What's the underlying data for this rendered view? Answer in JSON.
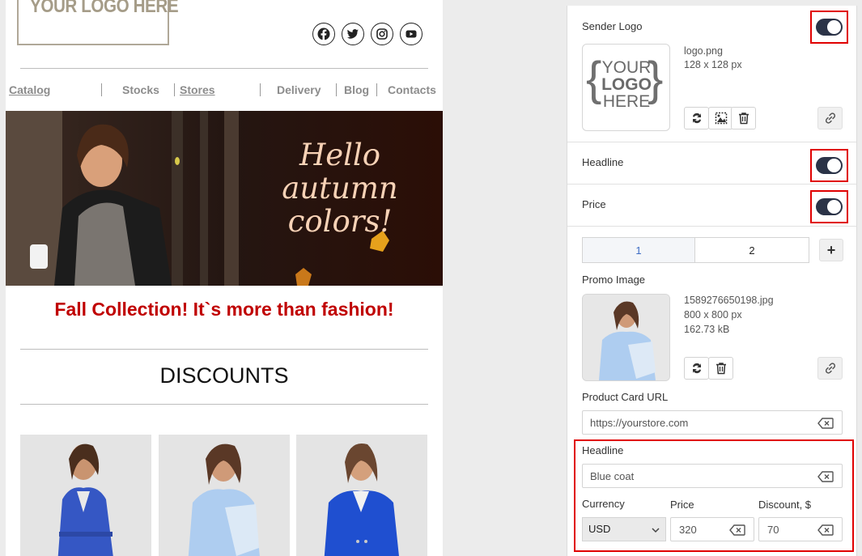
{
  "email": {
    "logo_text": "YOUR LOGO HERE",
    "social": [
      "facebook-icon",
      "twitter-icon",
      "instagram-icon",
      "youtube-icon"
    ],
    "nav": [
      "Catalog",
      "Stocks",
      "Stores",
      "Delivery",
      "Blog",
      "Contacts"
    ],
    "hero_lines": [
      "Hello",
      "autumn",
      "colors!"
    ],
    "promo_title": "Fall Collection! It`s more than fashion!",
    "section_title": "DISCOUNTS"
  },
  "panel": {
    "sender_logo": {
      "label": "Sender Logo",
      "enabled": true,
      "file_name": "logo.png",
      "dimensions": "128 x 128 px",
      "thumb_lines": [
        "YOUR",
        "LOGO",
        "HERE"
      ]
    },
    "headline_toggle": {
      "label": "Headline",
      "enabled": true
    },
    "price_toggle": {
      "label": "Price",
      "enabled": true
    },
    "tabs": [
      "1",
      "2"
    ],
    "add_label": "+",
    "promo_image": {
      "label": "Promo Image",
      "file_name": "1589276650198.jpg",
      "dimensions": "800 x 800 px",
      "size": "162.73 kB"
    },
    "product_url": {
      "label": "Product Card URL",
      "value": "https://yourstore.com"
    },
    "headline": {
      "label": "Headline",
      "value": "Blue coat"
    },
    "currency": {
      "label": "Currency",
      "value": "USD"
    },
    "price": {
      "label": "Price",
      "value": "320"
    },
    "discount": {
      "label": "Discount, $",
      "value": "70"
    }
  },
  "colors": {
    "promo_red": "#c00000",
    "highlight_red": "#e00000",
    "toggle_on": "#2b3347",
    "active_tab_text": "#3d6cc4"
  }
}
